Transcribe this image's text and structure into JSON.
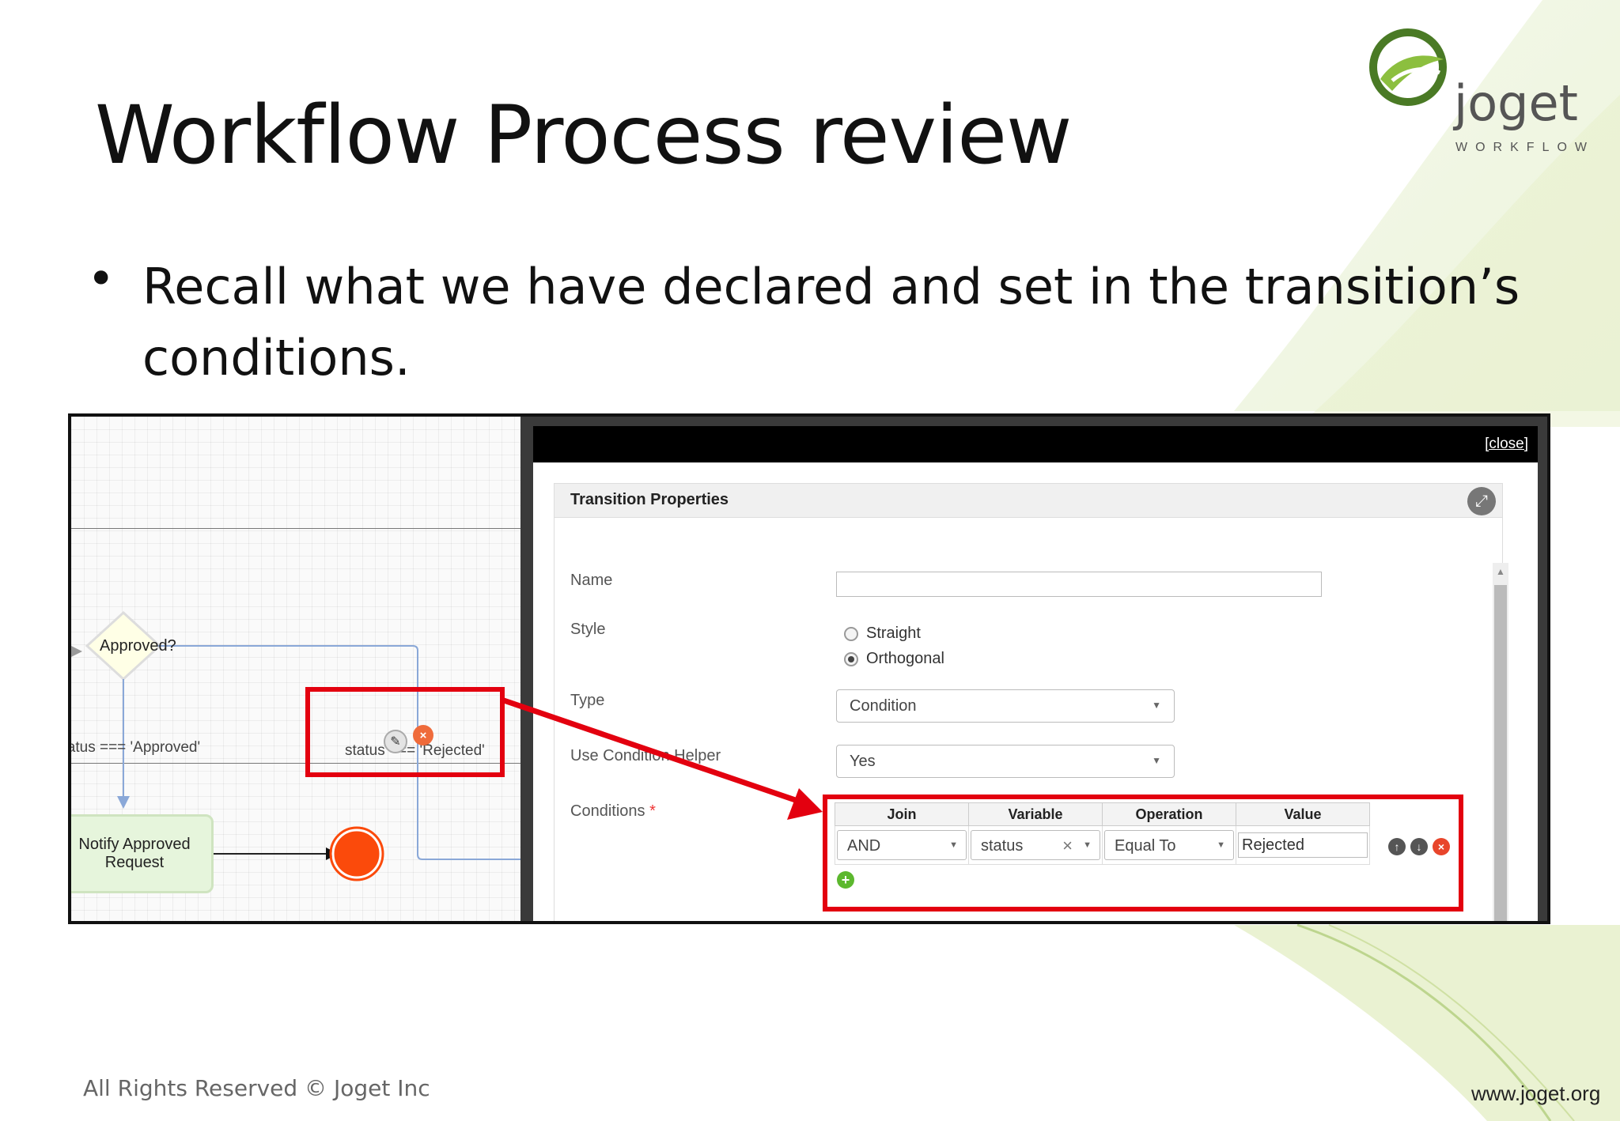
{
  "slide": {
    "title": "Workflow Process review",
    "bullet_symbol": "•",
    "bullet_text": "Recall what we have declared and set in the transition’s conditions.",
    "copyright": "All Rights Reserved © Joget Inc",
    "url": "www.joget.org",
    "logo": {
      "name": "joget",
      "tagline": "WORKFLOW"
    }
  },
  "process_canvas": {
    "decision_label": "Approved?",
    "approved_condition": "status === 'Approved'",
    "rejected_condition": "status === 'Rejected'",
    "task_label_line1": "Notify Approved",
    "task_label_line2": "Request",
    "edit_icon": "pencil-icon",
    "delete_icon": "close-circle-icon"
  },
  "dialog": {
    "close_label": "[close]",
    "title": "Transition Properties",
    "fields": {
      "name_label": "Name",
      "name_value": "",
      "style_label": "Style",
      "style_options": [
        "Straight",
        "Orthogonal"
      ],
      "style_selected": "Orthogonal",
      "type_label": "Type",
      "type_value": "Condition",
      "helper_label": "Use Condition Helper",
      "helper_value": "Yes",
      "conditions_label": "Conditions",
      "required_mark": "*"
    },
    "conditions_table": {
      "headers": [
        "Join",
        "Variable",
        "Operation",
        "Value"
      ],
      "rows": [
        {
          "join": "AND",
          "variable": "status",
          "operation": "Equal To",
          "value": "Rejected"
        }
      ]
    }
  },
  "colors": {
    "highlight": "#e3000f",
    "end_event": "#fb4a0b",
    "task_fill": "#e6f5dc",
    "logo_green": "#4a8a2a"
  }
}
